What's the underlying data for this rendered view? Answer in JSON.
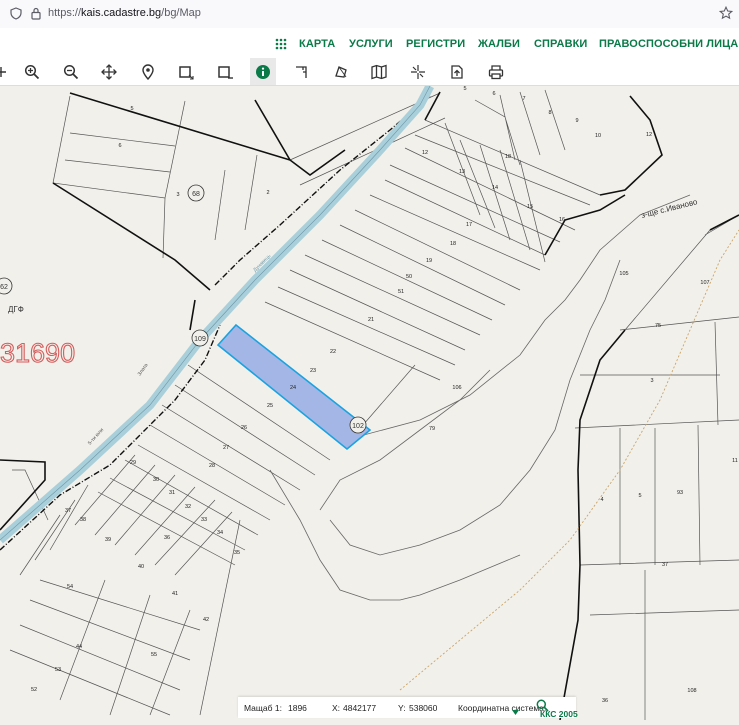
{
  "browser": {
    "url_prefix": "https://",
    "url_host": "kais.cadastre.bg",
    "url_path": "/bg/Map"
  },
  "nav": [
    "КАРТА",
    "УСЛУГИ",
    "РЕГИСТРИ",
    "ЖАЛБИ",
    "СПРАВКИ",
    "ПРАВОСПОСОБНИ ЛИЦА"
  ],
  "toolbar": [
    "select-icon",
    "zoom-in-icon",
    "zoom-out-icon",
    "pan-icon",
    "location-pin-icon",
    "select-rectangle-icon",
    "clear-selection-icon",
    "info-icon",
    "measure-distance-icon",
    "measure-area-icon",
    "layers-map-icon",
    "coordinates-icon",
    "upload-icon",
    "print-icon"
  ],
  "colors": {
    "brand_green": "#0a7a48",
    "selected_parcel": "#a4b6e6",
    "selected_outline": "#1aa3e0",
    "river": "#a9cfdb"
  },
  "map": {
    "land_label": "31690",
    "dgf_label": "ДГФ",
    "locality_label": "з-ще с.Иваново",
    "river_label": "Дунавець",
    "road_label": "Злата",
    "road_label_2": "5-ти юли",
    "plot_badges": [
      "68",
      "109",
      "102",
      "62",
      "108",
      "18"
    ],
    "parcels": [
      "5",
      "6",
      "7",
      "8",
      "9",
      "10",
      "12",
      "13",
      "14",
      "15",
      "16",
      "17",
      "18",
      "19",
      "50",
      "51",
      "21",
      "22",
      "23",
      "24",
      "25",
      "26",
      "27",
      "28",
      "29",
      "30",
      "31",
      "32",
      "33",
      "34",
      "35",
      "36",
      "37",
      "38",
      "39",
      "40",
      "41",
      "42",
      "44",
      "52",
      "53",
      "54",
      "55",
      "3",
      "2",
      "6",
      "5",
      "1",
      "3",
      "4",
      "5",
      "93",
      "107",
      "105",
      "106",
      "79",
      "75",
      "37",
      "36",
      "108",
      "12",
      "11",
      "18"
    ]
  },
  "status": {
    "scale_label": "Мащаб 1:",
    "scale_value": "1896",
    "x_label": "X:",
    "x_value": "4842177",
    "y_label": "Y:",
    "y_value": "538060",
    "crs_label": "Координатна система:",
    "crs_value": "ККС 2005"
  }
}
